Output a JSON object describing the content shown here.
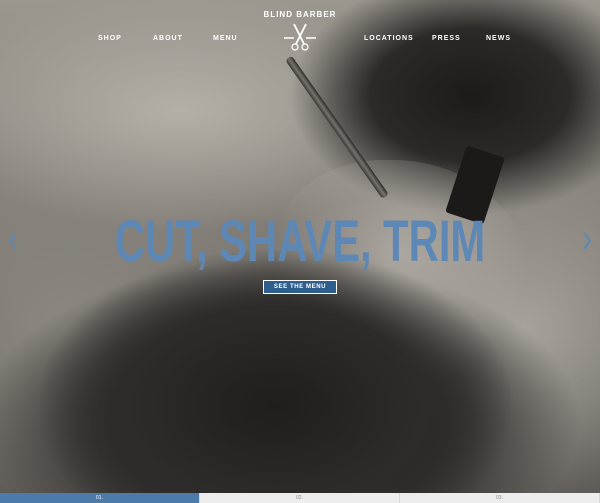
{
  "nav": {
    "left": [
      "SHOP",
      "ABOUT",
      "MENU"
    ],
    "right": [
      "LOCATIONS",
      "PRESS",
      "NEWS"
    ]
  },
  "logo": {
    "text": "BLIND BARBER",
    "icon": "scissors-icon"
  },
  "hero": {
    "headline": "CUT, SHAVE, TRIM",
    "cta": "SEE THE MENU",
    "prev_icon": "chevron-left-icon",
    "next_icon": "chevron-right-icon"
  },
  "slider": {
    "slides": [
      "01.",
      "02.",
      "03."
    ],
    "active": 0
  },
  "colors": {
    "accent": "#5d88b6",
    "button": "#2e5e8e",
    "active_slide": "#4c7aa9"
  }
}
